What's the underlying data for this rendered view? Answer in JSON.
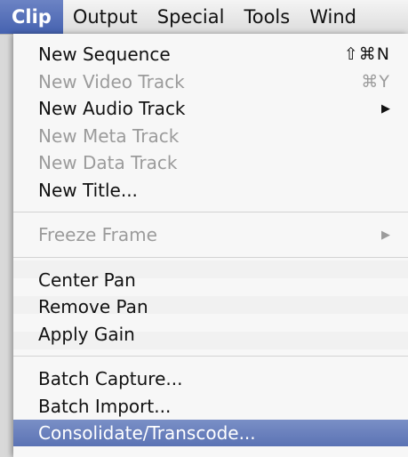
{
  "menubar": {
    "items": [
      {
        "label": "Clip",
        "active": true
      },
      {
        "label": "Output",
        "active": false
      },
      {
        "label": "Special",
        "active": false
      },
      {
        "label": "Tools",
        "active": false
      },
      {
        "label": "Wind",
        "active": false
      }
    ]
  },
  "clip_menu": {
    "groups": [
      [
        {
          "label": "New Sequence",
          "shortcut": "⇧⌘N",
          "enabled": true,
          "submenu": false
        },
        {
          "label": "New Video Track",
          "shortcut": "⌘Y",
          "enabled": false,
          "submenu": false
        },
        {
          "label": "New Audio Track",
          "shortcut": "",
          "enabled": true,
          "submenu": true
        },
        {
          "label": "New Meta Track",
          "shortcut": "",
          "enabled": false,
          "submenu": false
        },
        {
          "label": "New Data Track",
          "shortcut": "",
          "enabled": false,
          "submenu": false
        },
        {
          "label": "New Title...",
          "shortcut": "",
          "enabled": true,
          "submenu": false
        }
      ],
      [
        {
          "label": "Freeze Frame",
          "shortcut": "",
          "enabled": false,
          "submenu": true
        }
      ],
      [
        {
          "label": "Center Pan",
          "shortcut": "",
          "enabled": true,
          "submenu": false
        },
        {
          "label": "Remove Pan",
          "shortcut": "",
          "enabled": true,
          "submenu": false
        },
        {
          "label": "Apply Gain",
          "shortcut": "",
          "enabled": true,
          "submenu": false
        }
      ],
      [
        {
          "label": "Batch Capture...",
          "shortcut": "",
          "enabled": true,
          "submenu": false
        },
        {
          "label": "Batch Import...",
          "shortcut": "",
          "enabled": true,
          "submenu": false
        },
        {
          "label": "Consolidate/Transcode...",
          "shortcut": "",
          "enabled": true,
          "submenu": false,
          "selected": true
        }
      ]
    ],
    "submenu_arrow": "▶"
  },
  "colors": {
    "selection": "#5b73b4",
    "disabled_text": "#9b9b9b",
    "text": "#111111"
  }
}
